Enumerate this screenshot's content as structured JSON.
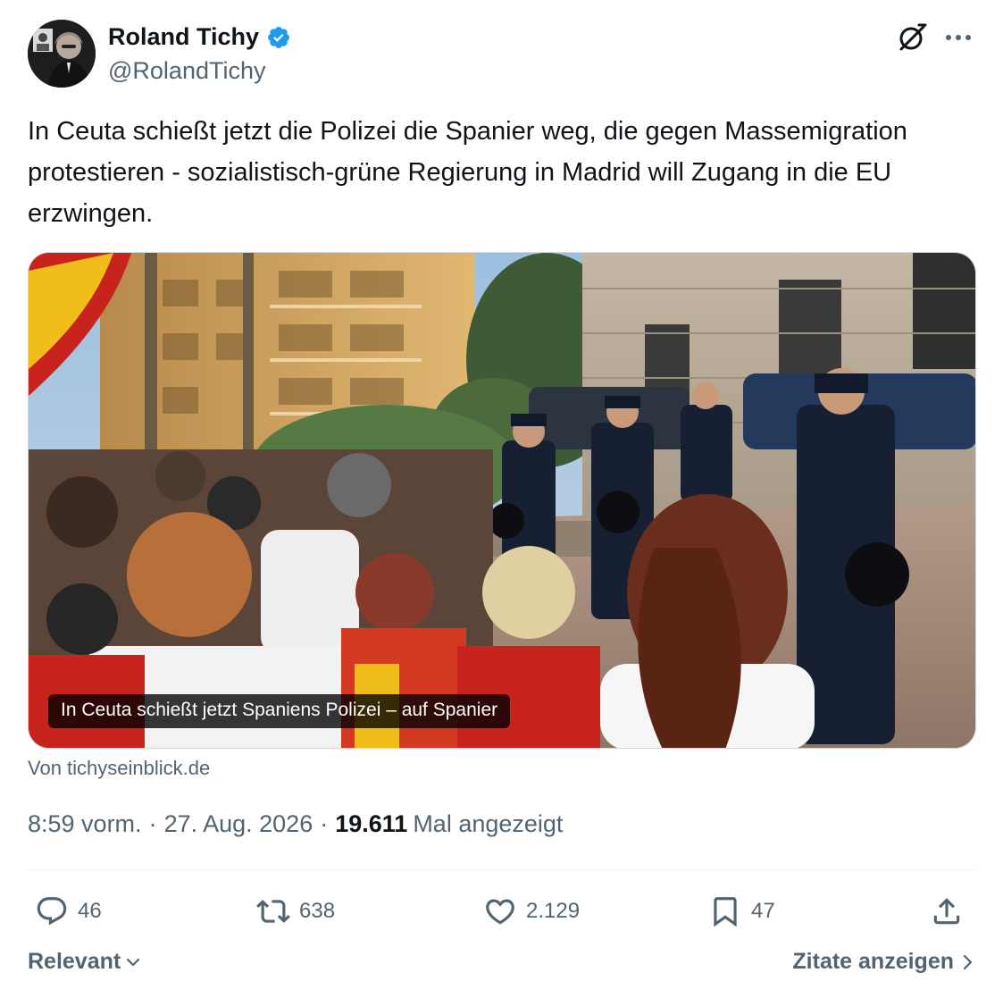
{
  "author": {
    "display_name": "Roland Tichy",
    "handle": "@RolandTichy",
    "verified_icon": "verified-badge-icon",
    "verified_color": "#1d9bf0"
  },
  "tweet": {
    "text": "In Ceuta schießt jetzt die Polizei die Spanier weg, die gegen Massemigration protestieren - sozialistisch-grüne Regierung in Madrid will Zugang in die EU erzwingen."
  },
  "card": {
    "caption": "In Ceuta schießt jetzt Spaniens Polizei – auf Spanier",
    "source": "Von tichyseinblick.de"
  },
  "meta": {
    "time": "8:59 vorm.",
    "separator": "·",
    "date": "27. Aug. 2026",
    "views_count": "19.611",
    "views_label": "Mal angezeigt"
  },
  "actions": {
    "replies": "46",
    "reposts": "638",
    "likes": "2.129",
    "bookmarks": "47"
  },
  "footer": {
    "sort_label": "Relevant",
    "quotes_label": "Zitate anzeigen"
  },
  "colors": {
    "text_primary": "#0f1419",
    "text_secondary": "#536471",
    "border": "#cfd9de",
    "accent": "#1d9bf0"
  }
}
